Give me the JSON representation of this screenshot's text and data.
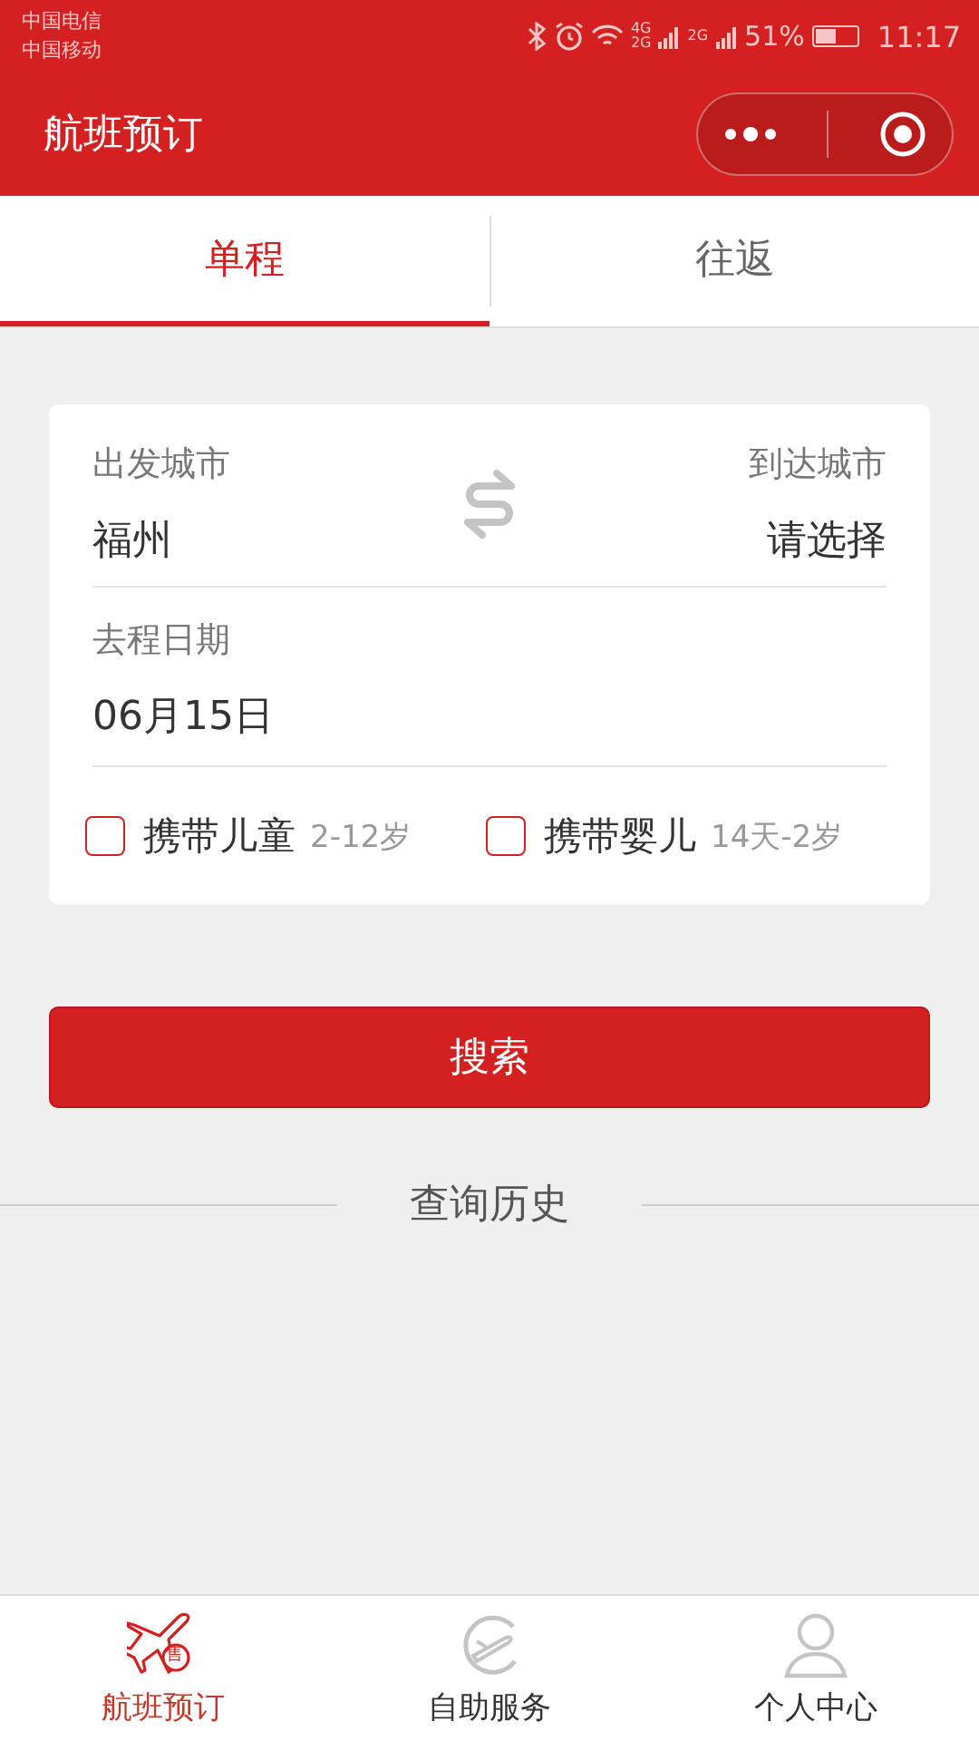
{
  "status_bar": {
    "carriers": [
      "中国电信",
      "中国移动"
    ],
    "network_labels": [
      "4G",
      "2G",
      "2G"
    ],
    "battery": "51%",
    "time": "11:17"
  },
  "header": {
    "title": "航班预订"
  },
  "tabs": [
    {
      "label": "单程",
      "selected": true
    },
    {
      "label": "往返",
      "selected": false
    }
  ],
  "form": {
    "from_label": "出发城市",
    "from_value": "福州",
    "to_label": "到达城市",
    "to_value": "请选择",
    "date_label": "去程日期",
    "date_value": "06月15日",
    "options": [
      {
        "label": "携带儿童",
        "hint": "2-12岁",
        "checked": false
      },
      {
        "label": "携带婴儿",
        "hint": "14天-2岁",
        "checked": false
      }
    ]
  },
  "search_button": "搜索",
  "history_title": "查询历史",
  "nav": [
    {
      "label": "航班预订",
      "kind": "plane",
      "selected": true,
      "badge": "售"
    },
    {
      "label": "自助服务",
      "kind": "service",
      "selected": false
    },
    {
      "label": "个人中心",
      "kind": "person",
      "selected": false
    }
  ]
}
